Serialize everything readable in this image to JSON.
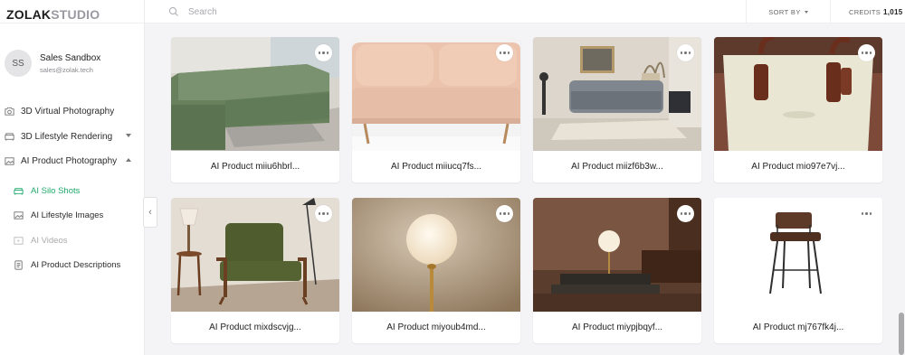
{
  "brand": {
    "part1": "ZOLAK",
    "part2": "STUDIO"
  },
  "user": {
    "initials": "SS",
    "name": "Sales Sandbox",
    "email": "sales@zolak.tech"
  },
  "nav": {
    "virtual_photography": "3D Virtual Photography",
    "lifestyle_rendering": "3D Lifestyle Rendering",
    "ai_product_photography": "AI Product Photography",
    "sub": {
      "silo_shots": "AI Silo Shots",
      "lifestyle_images": "AI Lifestyle Images",
      "videos": "AI Videos",
      "product_descriptions": "AI Product Descriptions"
    }
  },
  "header": {
    "search_placeholder": "Search",
    "sort_label": "SORT BY",
    "credits_label": "CREDITS",
    "credits_value": "1,015"
  },
  "products": [
    {
      "name": "AI Product miiu6hbrl...",
      "image": "green sectional sofa"
    },
    {
      "name": "AI Product miiucq7fs...",
      "image": "peach loveseat"
    },
    {
      "name": "AI Product miizf6b3w...",
      "image": "gray sofa in living room"
    },
    {
      "name": "AI Product mio97e7vj...",
      "image": "white handbag with brown handles"
    },
    {
      "name": "AI Product mixdscvjg...",
      "image": "green lounge armchair"
    },
    {
      "name": "AI Product miyoub4md...",
      "image": "globe table lamp"
    },
    {
      "name": "AI Product miypjbqyf...",
      "image": "globe lamp in dark living room"
    },
    {
      "name": "AI Product mj767fk4j...",
      "image": "brown leather bar stool"
    }
  ]
}
